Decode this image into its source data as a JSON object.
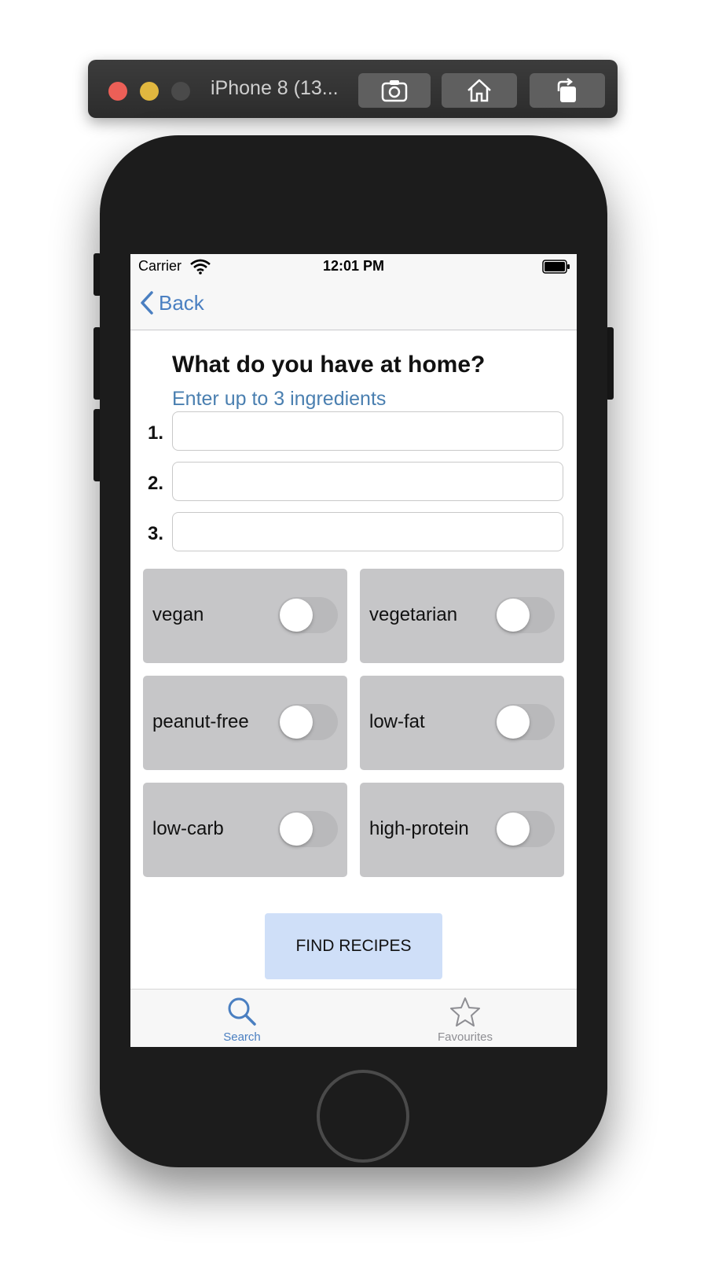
{
  "simulator": {
    "title": "iPhone 8 (13..."
  },
  "status_bar": {
    "carrier": "Carrier",
    "time": "12:01 PM"
  },
  "nav": {
    "back_label": "Back"
  },
  "main": {
    "title": "What do you have at home?",
    "subtitle": "Enter up to 3 ingredients",
    "ingredients": [
      {
        "number": "1.",
        "value": ""
      },
      {
        "number": "2.",
        "value": ""
      },
      {
        "number": "3.",
        "value": ""
      }
    ],
    "options": [
      {
        "label": "vegan",
        "on": false
      },
      {
        "label": "vegetarian",
        "on": false
      },
      {
        "label": "peanut-free",
        "on": false
      },
      {
        "label": "low-fat",
        "on": false
      },
      {
        "label": "low-carb",
        "on": false
      },
      {
        "label": "high-protein",
        "on": false
      }
    ],
    "find_button": "FIND RECIPES"
  },
  "tab_bar": {
    "tabs": [
      {
        "label": "Search",
        "icon": "search-icon",
        "active": true
      },
      {
        "label": "Favourites",
        "icon": "star-icon",
        "active": false
      }
    ]
  },
  "colors": {
    "accent": "#4a7fc1",
    "inactive_tab": "#8e8e93",
    "option_bg": "#c6c6c8",
    "button_bg": "#cfdff8"
  }
}
